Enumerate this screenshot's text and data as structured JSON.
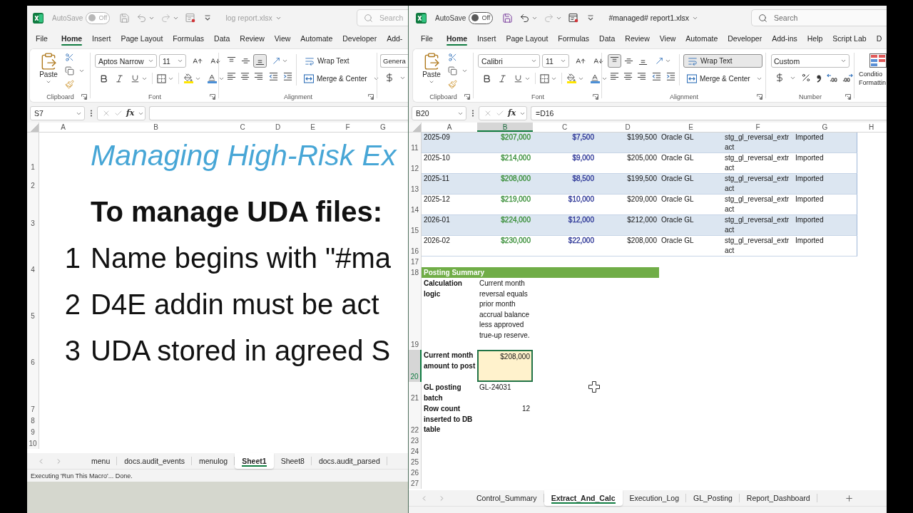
{
  "windows": [
    {
      "active": false,
      "title_bar": {
        "autosave_label": "AutoSave",
        "autosave": {
          "on": false,
          "label": "Off"
        },
        "file_name": "log report.xlsx",
        "search": {
          "placeholder": "Search"
        }
      },
      "ribbon_tabs": [
        {
          "label": "File",
          "selected": false
        },
        {
          "label": "Home",
          "selected": true
        },
        {
          "label": "Insert",
          "selected": false
        },
        {
          "label": "Page Layout",
          "selected": false
        },
        {
          "label": "Formulas",
          "selected": false
        },
        {
          "label": "Data",
          "selected": false
        },
        {
          "label": "Review",
          "selected": false
        },
        {
          "label": "View",
          "selected": false
        },
        {
          "label": "Automate",
          "selected": false
        },
        {
          "label": "Developer",
          "selected": false
        },
        {
          "label": "Add-",
          "selected": false
        }
      ],
      "ribbon": {
        "clipboard": {
          "paste_label": "Paste",
          "group_label": "Clipboard"
        },
        "font": {
          "font_name": "Aptos Narrow",
          "font_size": "11",
          "group_label": "Font"
        },
        "alignment": {
          "vertical": [
            {
              "kind": "top",
              "selected": false
            },
            {
              "kind": "middle",
              "selected": false
            },
            {
              "kind": "bottom",
              "selected": true
            }
          ],
          "wrap_text": {
            "label": "Wrap Text",
            "selected": false
          },
          "merge_label": "Merge & Center",
          "group_label": "Alignment"
        },
        "number": {
          "format": "Genera",
          "buttons": [
            {
              "kind": "currency"
            }
          ]
        }
      },
      "formula_bar": {
        "name_box": "S7",
        "function_label": "fx"
      },
      "sheet": {
        "column_headers": [
          {
            "label": "A"
          },
          {
            "label": "B"
          },
          {
            "label": "C"
          },
          {
            "label": "D"
          },
          {
            "label": "E"
          },
          {
            "label": "F"
          },
          {
            "label": "G"
          }
        ],
        "rows": [
          {
            "row": "1",
            "kind": "title",
            "text": "Managing High-Risk Ex"
          },
          {
            "row": "2",
            "kind": "spacer"
          },
          {
            "row": "3",
            "kind": "heading",
            "text": "To manage UDA files:"
          },
          {
            "row": "4",
            "kind": "step",
            "number": "1",
            "text": "Name begins with \"#ma"
          },
          {
            "row": "5",
            "kind": "step",
            "number": "2",
            "text": "D4E addin must be act"
          },
          {
            "row": "6",
            "kind": "step",
            "number": "3",
            "text": "UDA stored in agreed S"
          },
          {
            "row": "7",
            "kind": "tall_blank"
          },
          {
            "row": "8",
            "kind": "blank"
          },
          {
            "row": "9",
            "kind": "blank"
          },
          {
            "row": "10",
            "kind": "blank"
          }
        ]
      },
      "sheet_tabs": [
        {
          "label": "menu",
          "selected": false
        },
        {
          "label": "docs.audit_events",
          "selected": false
        },
        {
          "label": "menulog",
          "selected": false
        },
        {
          "label": "Sheet1",
          "selected": true
        },
        {
          "label": "Sheet8",
          "selected": false
        },
        {
          "label": "docs.audit_parsed",
          "selected": false
        }
      ],
      "status_bar": {
        "text": "Executing 'Run This Macro'... Done."
      }
    },
    {
      "active": true,
      "title_bar": {
        "autosave_label": "AutoSave",
        "autosave": {
          "on": false,
          "label": "Off"
        },
        "file_name": "#managed# report1.xlsx",
        "search": {
          "placeholder": "Search"
        }
      },
      "ribbon_tabs": [
        {
          "label": "File",
          "selected": false
        },
        {
          "label": "Home",
          "selected": true
        },
        {
          "label": "Insert",
          "selected": false
        },
        {
          "label": "Page Layout",
          "selected": false
        },
        {
          "label": "Formulas",
          "selected": false
        },
        {
          "label": "Data",
          "selected": false
        },
        {
          "label": "Review",
          "selected": false
        },
        {
          "label": "View",
          "selected": false
        },
        {
          "label": "Automate",
          "selected": false
        },
        {
          "label": "Developer",
          "selected": false
        },
        {
          "label": "Add-ins",
          "selected": false
        },
        {
          "label": "Help",
          "selected": false
        },
        {
          "label": "Script Lab",
          "selected": false
        },
        {
          "label": "D",
          "selected": false
        }
      ],
      "ribbon": {
        "clipboard": {
          "paste_label": "Paste",
          "group_label": "Clipboard"
        },
        "font": {
          "font_name": "Calibri",
          "font_size": "11",
          "group_label": "Font"
        },
        "alignment": {
          "vertical": [
            {
              "kind": "top",
              "selected": true
            },
            {
              "kind": "middle",
              "selected": false
            },
            {
              "kind": "bottom",
              "selected": false
            }
          ],
          "wrap_text": {
            "label": "Wrap Text",
            "selected": true
          },
          "merge_label": "Merge & Center",
          "group_label": "Alignment"
        },
        "number": {
          "format": "Custom",
          "buttons": [
            {
              "kind": "currency"
            },
            {
              "kind": "percent"
            },
            {
              "kind": "comma"
            },
            {
              "kind": "increase_decimal"
            },
            {
              "kind": "decrease_decimal"
            }
          ],
          "group_label": "Number"
        },
        "conditional_formatting": {
          "label": "Conditio Formattin"
        }
      },
      "formula_bar": {
        "name_box": "B20",
        "function_label": "fx",
        "formula": "=D16"
      },
      "sheet": {
        "column_headers": [
          {
            "label": "A",
            "selected": false
          },
          {
            "label": "B",
            "selected": true
          },
          {
            "label": "C",
            "selected": false
          },
          {
            "label": "D",
            "selected": false
          },
          {
            "label": "E",
            "selected": false
          },
          {
            "label": "F",
            "selected": false
          },
          {
            "label": "G",
            "selected": false
          },
          {
            "label": "H",
            "selected": false
          }
        ],
        "table_columns": [
          {
            "kind": "text"
          },
          {
            "kind": "amount",
            "color": "#3a8f3a"
          },
          {
            "kind": "amount",
            "color": "#2b3596"
          },
          {
            "kind": "amount"
          },
          {
            "kind": "text"
          },
          {
            "kind": "text"
          },
          {
            "kind": "text"
          }
        ],
        "rows": [
          {
            "row": "11",
            "kind": "table_row",
            "selected": false,
            "banded": true,
            "cells": [
              "2025-09",
              "$207,000",
              "$7,500",
              "$199,500",
              "Oracle GL",
              "stg_gl_reversal_extract",
              "Imported"
            ]
          },
          {
            "row": "12",
            "kind": "table_row",
            "selected": false,
            "banded": false,
            "cells": [
              "2025-10",
              "$214,000",
              "$9,000",
              "$205,000",
              "Oracle GL",
              "stg_gl_reversal_extract",
              "Imported"
            ]
          },
          {
            "row": "13",
            "kind": "table_row",
            "selected": false,
            "banded": true,
            "cells": [
              "2025-11",
              "$208,000",
              "$8,500",
              "$199,500",
              "Oracle GL",
              "stg_gl_reversal_extract",
              "Imported"
            ]
          },
          {
            "row": "14",
            "kind": "table_row",
            "selected": false,
            "banded": false,
            "cells": [
              "2025-12",
              "$219,000",
              "$10,000",
              "$209,000",
              "Oracle GL",
              "stg_gl_reversal_extract",
              "Imported"
            ]
          },
          {
            "row": "15",
            "kind": "table_row",
            "selected": false,
            "banded": true,
            "cells": [
              "2026-01",
              "$224,000",
              "$12,000",
              "$212,000",
              "Oracle GL",
              "stg_gl_reversal_extract",
              "Imported"
            ]
          },
          {
            "row": "16",
            "kind": "table_row",
            "selected": false,
            "banded": false,
            "cells": [
              "2026-02",
              "$230,000",
              "$22,000",
              "$208,000",
              "Oracle GL",
              "stg_gl_reversal_extract",
              "Imported"
            ]
          },
          {
            "row": "17",
            "kind": "blank",
            "selected": false
          },
          {
            "row": "18",
            "kind": "section",
            "selected": false,
            "title": "Posting Summary"
          },
          {
            "row": "19",
            "kind": "field",
            "selected": false,
            "label": "Calculation logic",
            "value": {
              "kind": "text",
              "text": "Current month reversal equals prior month accrual balance less approved true-up reserve."
            },
            "highlighted": false
          },
          {
            "row": "20",
            "kind": "field",
            "selected": true,
            "label": "Current month amount to post",
            "value": {
              "kind": "number",
              "text": "$208,000"
            },
            "highlighted": true
          },
          {
            "row": "21",
            "kind": "field",
            "selected": false,
            "label": "GL posting batch",
            "value": {
              "kind": "text",
              "text": "GL-24031"
            },
            "highlighted": false
          },
          {
            "row": "22",
            "kind": "field",
            "selected": false,
            "label": "Row count inserted to DB table",
            "value": {
              "kind": "number",
              "text": "12"
            },
            "highlighted": false
          },
          {
            "row": "23",
            "kind": "blank",
            "selected": false
          },
          {
            "row": "24",
            "kind": "blank",
            "selected": false
          },
          {
            "row": "25",
            "kind": "blank",
            "selected": false
          },
          {
            "row": "26",
            "kind": "blank",
            "selected": false
          },
          {
            "row": "27",
            "kind": "blank",
            "selected": false
          }
        ]
      },
      "sheet_tabs": [
        {
          "label": "Control_Summary",
          "selected": false
        },
        {
          "label": "Extract_And_Calc",
          "selected": true
        },
        {
          "label": "Execution_Log",
          "selected": false
        },
        {
          "label": "GL_Posting",
          "selected": false
        },
        {
          "label": "Report_Dashboard",
          "selected": false
        }
      ],
      "add_sheet_button": true
    }
  ]
}
